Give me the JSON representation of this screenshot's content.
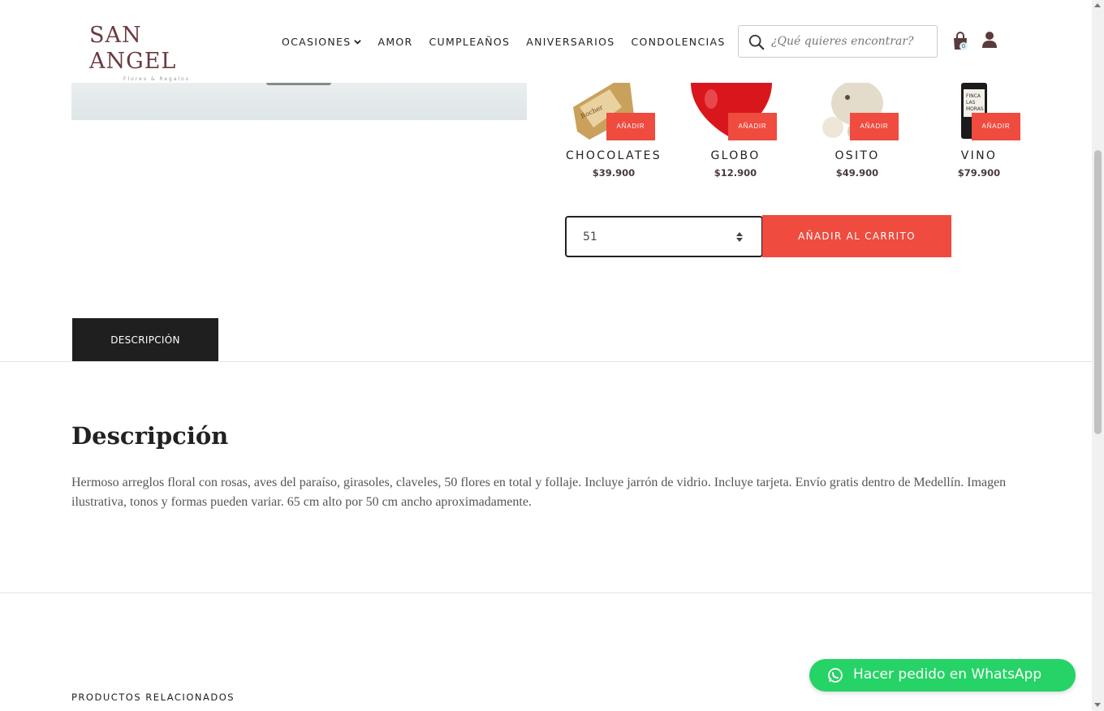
{
  "brand": {
    "name": "SAN ANGEL",
    "tagline": "Flores & Regalos",
    "color": "#6b3a3f"
  },
  "nav": {
    "items": [
      {
        "label": "OCASIONES",
        "has_dropdown": true
      },
      {
        "label": "AMOR"
      },
      {
        "label": "CUMPLEAÑOS"
      },
      {
        "label": "ANIVERSARIOS"
      },
      {
        "label": "CONDOLENCIAS"
      }
    ]
  },
  "search": {
    "placeholder": "¿Qué quieres encontrar?",
    "icon": "search-icon"
  },
  "cart": {
    "count": "0",
    "icon": "shopping-bag-icon"
  },
  "account": {
    "icon": "user-icon"
  },
  "addons": [
    {
      "name": "CHOCOLATES",
      "price": "$39.900",
      "button": "AÑADIR",
      "image": "ferrero-chocolates"
    },
    {
      "name": "GLOBO",
      "price": "$12.900",
      "button": "AÑADIR",
      "image": "red-heart-balloon"
    },
    {
      "name": "OSITO",
      "price": "$49.900",
      "button": "AÑADIR",
      "image": "teddy-bear"
    },
    {
      "name": "VINO",
      "price": "$79.900",
      "button": "AÑADIR",
      "image": "wine-bottle"
    }
  ],
  "purchase": {
    "quantity": "51",
    "add_to_cart": "AÑADIR AL CARRITO"
  },
  "tabs": {
    "description": "DESCRIPCIÓN"
  },
  "description": {
    "title": "Descripción",
    "text": "Hermoso arreglos floral con rosas, aves del paraíso, girasoles, claveles, 50 flores en total y follaje. Incluye jarrón de vidrio. Incluye tarjeta. Envío gratis dentro de Medellín. Imagen ilustrativa, tonos y formas pueden variar. 65 cm alto por 50 cm ancho aproximadamente."
  },
  "related": {
    "title": "PRODUCTOS RELACIONADOS"
  },
  "whatsapp": {
    "label": "Hacer pedido en WhatsApp",
    "color": "#25d366"
  },
  "accent_color": "#ef4b3e"
}
